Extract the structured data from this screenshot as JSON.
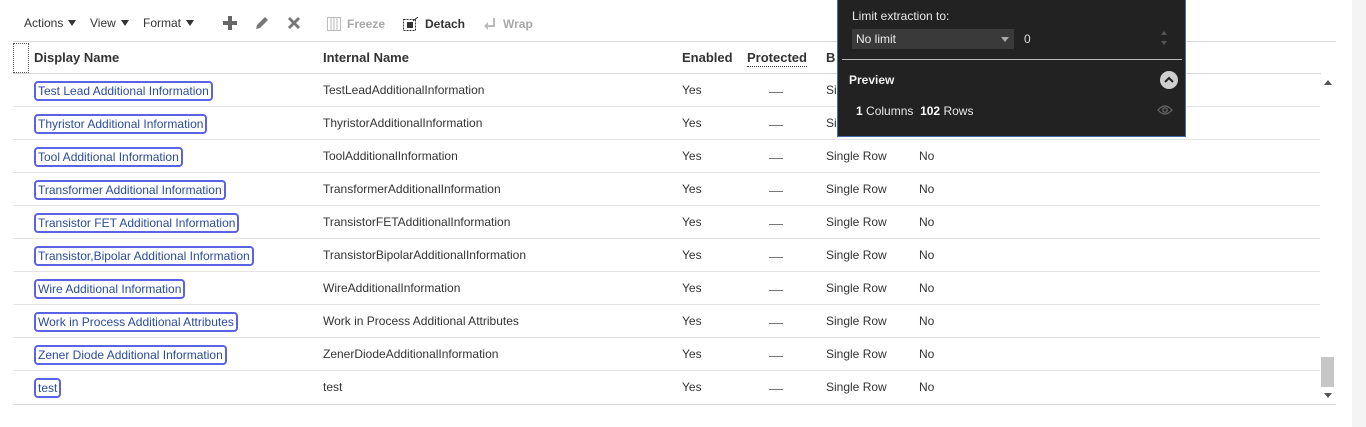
{
  "toolbar": {
    "actions_label": "Actions",
    "view_label": "View",
    "format_label": "Format",
    "add_icon": "plus-icon",
    "edit_icon": "pencil-icon",
    "delete_icon": "x-icon",
    "freeze_label": "Freeze",
    "detach_label": "Detach",
    "wrap_label": "Wrap"
  },
  "table": {
    "headers": {
      "display_name": "Display Name",
      "internal_name": "Internal Name",
      "enabled": "Enabled",
      "protected": "Protected",
      "b": "B"
    },
    "rows": [
      {
        "display": "Test Lead Additional Information",
        "internal": "TestLeadAdditionalInformation",
        "enabled": "Yes",
        "behavior": "Si",
        "extra": ""
      },
      {
        "display": "Thyristor Additional Information",
        "internal": "ThyristorAdditionalInformation",
        "enabled": "Yes",
        "behavior": "Si",
        "extra": ""
      },
      {
        "display": "Tool Additional Information",
        "internal": "ToolAdditionalInformation",
        "enabled": "Yes",
        "behavior": "Single Row",
        "extra": "No"
      },
      {
        "display": "Transformer Additional Information",
        "internal": "TransformerAdditionalInformation",
        "enabled": "Yes",
        "behavior": "Single Row",
        "extra": "No"
      },
      {
        "display": "Transistor FET Additional Information",
        "internal": "TransistorFETAdditionalInformation",
        "enabled": "Yes",
        "behavior": "Single Row",
        "extra": "No"
      },
      {
        "display": "Transistor,Bipolar Additional Information",
        "internal": "TransistorBipolarAdditionalInformation",
        "enabled": "Yes",
        "behavior": "Single Row",
        "extra": "No"
      },
      {
        "display": "Wire Additional Information",
        "internal": "WireAdditionalInformation",
        "enabled": "Yes",
        "behavior": "Single Row",
        "extra": "No"
      },
      {
        "display": "Work in Process Additional Attributes",
        "internal": "Work in Process Additional Attributes",
        "enabled": "Yes",
        "behavior": "Single Row",
        "extra": "No"
      },
      {
        "display": "Zener Diode Additional Information",
        "internal": "ZenerDiodeAdditionalInformation",
        "enabled": "Yes",
        "behavior": "Single Row",
        "extra": "No"
      },
      {
        "display": "test",
        "internal": "test",
        "enabled": "Yes",
        "behavior": "Single Row",
        "extra": "No"
      }
    ]
  },
  "overlay": {
    "limit_label": "Limit extraction to:",
    "limit_value": "No limit",
    "limit_number": "0",
    "preview_label": "Preview",
    "columns_count": "1",
    "columns_label": "Columns",
    "rows_count": "102",
    "rows_label": "Rows"
  },
  "colors": {
    "accent_border": "#5a62e6",
    "overlay_bg": "#222222"
  }
}
